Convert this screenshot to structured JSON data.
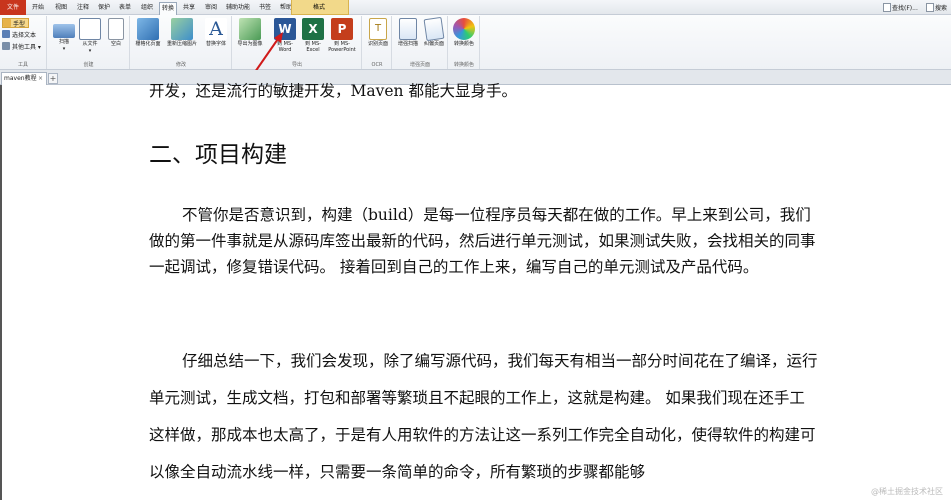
{
  "menubar": {
    "items": [
      {
        "label": "文件",
        "x": "file"
      },
      {
        "label": "开始"
      },
      {
        "label": "视图"
      },
      {
        "label": "注释"
      },
      {
        "label": "保护"
      },
      {
        "label": "表单"
      },
      {
        "label": "组织"
      },
      {
        "label": "转换",
        "active": true
      },
      {
        "label": "共享"
      },
      {
        "label": "审阅"
      },
      {
        "label": "辅助功能"
      },
      {
        "label": "书签"
      },
      {
        "label": "帮助"
      }
    ],
    "context_tab": "格式",
    "right_items": [
      "查找(F)...",
      "搜索"
    ]
  },
  "ribbon": {
    "tools_group": {
      "hand": "手型",
      "select_text": "选择文本",
      "other_tools": "其他工具",
      "label": "工具"
    },
    "create_group": {
      "scan": "扫描",
      "from_file": "从文件",
      "blank": "空白",
      "label": "创建"
    },
    "modify_group": {
      "optimize": "栅格化页面",
      "recompress": "重新压缩图片",
      "replace_font": "替换字体",
      "label": "修改"
    },
    "export_group": {
      "to_image": "导出为图像",
      "to_word_1": "到 MS-",
      "to_word_2": "Word",
      "to_excel_1": "到 MS-",
      "to_excel_2": "Excel",
      "to_ppt_1": "到 MS-",
      "to_ppt_2": "PowerPoint",
      "label": "导出"
    },
    "ocr_group": {
      "ocr": "识别页面",
      "label": "OCR"
    },
    "scan_group": {
      "enhance": "增强扫描",
      "deskew": "纠偏页面",
      "label": "增强页面"
    },
    "color_group": {
      "convert": "转换颜色",
      "label": "转换颜色"
    }
  },
  "tabs": {
    "doc_tab": "maven教程",
    "close": "×",
    "new_tab": "+"
  },
  "document": {
    "top_fragment": "开发，还是流行的敏捷开发，Maven 都能大显身手。",
    "heading": "二、项目构建",
    "para1": "不管你是否意识到，构建（build）是每一位程序员每天都在做的工作。早上来到公司，我们做的第一件事就是从源码库签出最新的代码，然后进行单元测试，如果测试失败，会找相关的同事一起调试，修复错误代码。 接着回到自己的工作上来，编写自己的单元测试及产品代码。",
    "para2": "仔细总结一下，我们会发现，除了编写源代码，我们每天有相当一部分时间花在了编译，运行单元测试，生成文档，打包和部署等繁琐且不起眼的工作上，这就是构建。 如果我们现在还手工这样做，那成本也太高了，于是有人用软件的方法让这一系列工作完全自动化，使得软件的构建可以像全自动流水线一样，只需要一条简单的命令，所有繁琐的步骤都能够"
  },
  "watermark": "@稀土掘金技术社区",
  "colors": {
    "file_tab": "#c8351d",
    "word": "#2b5797",
    "excel": "#1e7145",
    "ppt": "#c43e1c",
    "annotation_arrow": "#d01a1a"
  }
}
